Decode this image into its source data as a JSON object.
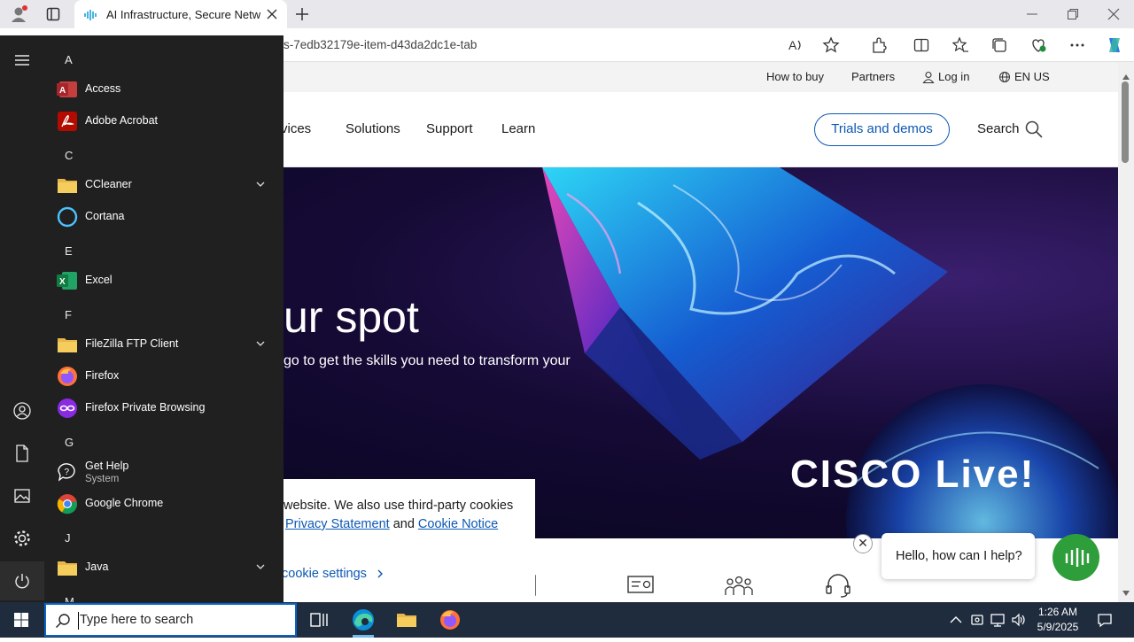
{
  "browser": {
    "tab_title": "AI Infrastructure, Secure Network",
    "url_visible": "s-7edb32179e-item-d43da2dc1e-tab"
  },
  "page": {
    "util_links": {
      "how_to_buy": "How to buy",
      "partners": "Partners",
      "login": "Log in",
      "locale": "EN US"
    },
    "nav": {
      "services": "rvices",
      "solutions": "Solutions",
      "support": "Support",
      "learn": "Learn",
      "trials": "Trials and demos",
      "search": "Search"
    },
    "hero": {
      "title": "ur spot",
      "subtitle": "go to get the skills you need to transform your",
      "brand": "CISCO Live!"
    },
    "cookie": {
      "line1": "website. We also use third-party cookies",
      "privacy_link": "Privacy Statement",
      "and_text": " and ",
      "cookie_link": "Cookie Notice",
      "settings": "cookie settings"
    },
    "chat": {
      "text": "Hello, how can I help?",
      "close": "✕"
    }
  },
  "start_menu": {
    "letters": {
      "a": "A",
      "c": "C",
      "e": "E",
      "f": "F",
      "g": "G",
      "j": "J",
      "m": "M"
    },
    "apps": {
      "access": "Access",
      "acrobat": "Adobe Acrobat",
      "ccleaner": "CCleaner",
      "cortana": "Cortana",
      "excel": "Excel",
      "filezilla": "FileZilla FTP Client",
      "firefox": "Firefox",
      "firefox_private": "Firefox Private Browsing",
      "get_help": "Get Help",
      "get_help_sub": "System",
      "chrome": "Google Chrome",
      "java": "Java"
    }
  },
  "taskbar": {
    "search_placeholder": "Type here to search",
    "time": "1:26 AM",
    "date": "5/9/2025"
  },
  "colors": {
    "accent_blue": "#0d58b3",
    "startmenu_bg": "#202020",
    "taskbar_bg": "#1f2c3d"
  }
}
